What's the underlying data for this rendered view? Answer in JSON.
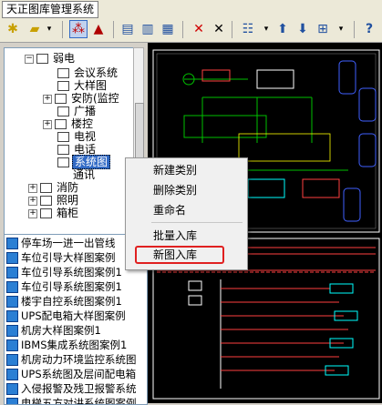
{
  "window": {
    "title": "天正图库管理系统"
  },
  "tree": {
    "items": [
      {
        "label": "弱电",
        "level": 0
      },
      {
        "label": "会议系统",
        "level": 1
      },
      {
        "label": "大样图",
        "level": 1
      },
      {
        "label": "安防(监控",
        "level": 1
      },
      {
        "label": "广播",
        "level": 1
      },
      {
        "label": "楼控",
        "level": 1
      },
      {
        "label": "电视",
        "level": 1
      },
      {
        "label": "电话",
        "level": 1
      },
      {
        "label": "系统图",
        "level": 1
      },
      {
        "label": "通讯",
        "level": 1
      },
      {
        "label": "消防",
        "level": 0
      },
      {
        "label": "照明",
        "level": 0
      },
      {
        "label": "箱柜",
        "level": 0
      }
    ]
  },
  "list": {
    "items": [
      "停车场一进一出管线",
      "车位引导大样图案例",
      "车位引导系统图案例1",
      "车位引导系统图案例1",
      "楼宇自控系统图案例1",
      "UPS配电箱大样图案例",
      "机房大样图案例1",
      "IBMS集成系统图案例1",
      "机房动力环境监控系统图",
      "UPS系统图及层间配电箱",
      "入侵报警及残卫报警系统",
      "电梯五方对讲系统图案例"
    ]
  },
  "context_menu": {
    "items": [
      "新建类别",
      "删除类别",
      "重命名",
      "批量入库",
      "新图入库"
    ],
    "highlighted": "新图入库"
  },
  "colors": {
    "highlight_border": "#e02020",
    "selection": "#316ac5",
    "canvas": "#000000"
  }
}
